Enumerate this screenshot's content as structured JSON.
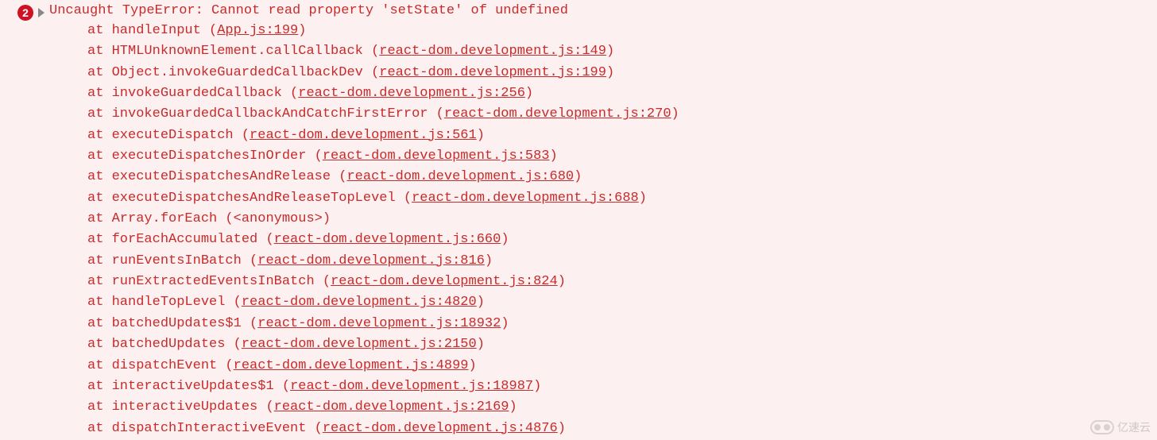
{
  "error": {
    "count": "2",
    "message": "Uncaught TypeError: Cannot read property 'setState' of undefined"
  },
  "stack": [
    {
      "at": "at ",
      "fn": "handleInput",
      "src": "App.js:199",
      "anon": false
    },
    {
      "at": "at ",
      "fn": "HTMLUnknownElement.callCallback",
      "src": "react-dom.development.js:149",
      "anon": false
    },
    {
      "at": "at ",
      "fn": "Object.invokeGuardedCallbackDev",
      "src": "react-dom.development.js:199",
      "anon": false
    },
    {
      "at": "at ",
      "fn": "invokeGuardedCallback",
      "src": "react-dom.development.js:256",
      "anon": false
    },
    {
      "at": "at ",
      "fn": "invokeGuardedCallbackAndCatchFirstError",
      "src": "react-dom.development.js:270",
      "anon": false
    },
    {
      "at": "at ",
      "fn": "executeDispatch",
      "src": "react-dom.development.js:561",
      "anon": false
    },
    {
      "at": "at ",
      "fn": "executeDispatchesInOrder",
      "src": "react-dom.development.js:583",
      "anon": false
    },
    {
      "at": "at ",
      "fn": "executeDispatchesAndRelease",
      "src": "react-dom.development.js:680",
      "anon": false
    },
    {
      "at": "at ",
      "fn": "executeDispatchesAndReleaseTopLevel",
      "src": "react-dom.development.js:688",
      "anon": false
    },
    {
      "at": "at ",
      "fn": "Array.forEach",
      "src": "<anonymous>",
      "anon": true
    },
    {
      "at": "at ",
      "fn": "forEachAccumulated",
      "src": "react-dom.development.js:660",
      "anon": false
    },
    {
      "at": "at ",
      "fn": "runEventsInBatch",
      "src": "react-dom.development.js:816",
      "anon": false
    },
    {
      "at": "at ",
      "fn": "runExtractedEventsInBatch",
      "src": "react-dom.development.js:824",
      "anon": false
    },
    {
      "at": "at ",
      "fn": "handleTopLevel",
      "src": "react-dom.development.js:4820",
      "anon": false
    },
    {
      "at": "at ",
      "fn": "batchedUpdates$1",
      "src": "react-dom.development.js:18932",
      "anon": false
    },
    {
      "at": "at ",
      "fn": "batchedUpdates",
      "src": "react-dom.development.js:2150",
      "anon": false
    },
    {
      "at": "at ",
      "fn": "dispatchEvent",
      "src": "react-dom.development.js:4899",
      "anon": false
    },
    {
      "at": "at ",
      "fn": "interactiveUpdates$1",
      "src": "react-dom.development.js:18987",
      "anon": false
    },
    {
      "at": "at ",
      "fn": "interactiveUpdates",
      "src": "react-dom.development.js:2169",
      "anon": false
    },
    {
      "at": "at ",
      "fn": "dispatchInteractiveEvent",
      "src": "react-dom.development.js:4876",
      "anon": false
    }
  ],
  "watermark": "亿速云"
}
